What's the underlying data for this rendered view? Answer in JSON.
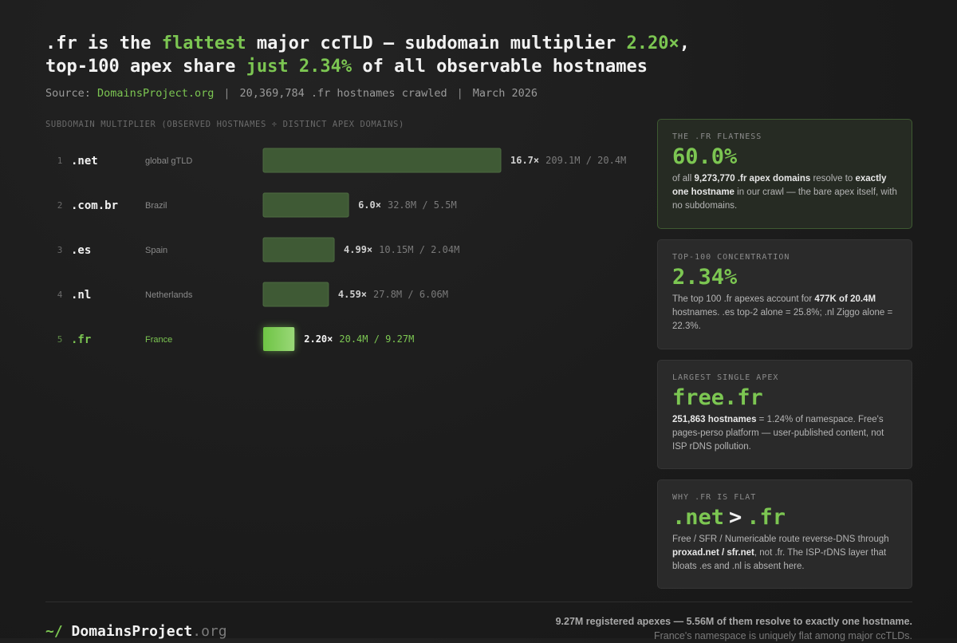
{
  "headline": {
    "l1_a": ".fr is the ",
    "l1_hl1": "flattest",
    "l1_b": " major ccTLD — subdomain multiplier ",
    "l1_hl2": "2.20×",
    "l1_c": ",",
    "l2_a": "top-100 apex share ",
    "l2_hl": "just 2.34%",
    "l2_b": " of all observable hostnames"
  },
  "source": {
    "prefix": "Source:",
    "link": "DomainsProject.org",
    "sep": "|",
    "crawl": "20,369,784 .fr hostnames crawled",
    "date": "March 2026"
  },
  "section_label": "SUBDOMAIN MULTIPLIER (OBSERVED HOSTNAMES ÷ DISTINCT APEX DOMAINS)",
  "chart_data": {
    "type": "bar",
    "orientation": "horizontal",
    "title": "",
    "xlabel": "",
    "ylabel": "",
    "xlim": [
      0,
      16.7
    ],
    "grid": false,
    "rows": [
      {
        "rank": "1",
        "tld": ".net",
        "country": "global gTLD",
        "value": 16.7,
        "value_label": "16.7×",
        "detail": "209.1M / 20.4M",
        "highlight": false
      },
      {
        "rank": "2",
        "tld": ".com.br",
        "country": "Brazil",
        "value": 6.0,
        "value_label": "6.0×",
        "detail": "32.8M / 5.5M",
        "highlight": false
      },
      {
        "rank": "3",
        "tld": ".es",
        "country": "Spain",
        "value": 4.99,
        "value_label": "4.99×",
        "detail": "10.15M / 2.04M",
        "highlight": false
      },
      {
        "rank": "4",
        "tld": ".nl",
        "country": "Netherlands",
        "value": 4.59,
        "value_label": "4.59×",
        "detail": "27.8M / 6.06M",
        "highlight": false
      },
      {
        "rank": "5",
        "tld": ".fr",
        "country": "France",
        "value": 2.2,
        "value_label": "2.20×",
        "detail": "20.4M / 9.27M",
        "highlight": true
      }
    ]
  },
  "cards": [
    {
      "label": "THE .FR FLATNESS",
      "big": "60.0%",
      "t1": "of all ",
      "b1": "9,273,770 .fr apex domains",
      "t2": " resolve to ",
      "b2": "exactly one hostname",
      "t3": " in our crawl — the bare apex itself, with no subdomains."
    },
    {
      "label": "TOP-100 CONCENTRATION",
      "big": "2.34%",
      "t1": "The top 100 .fr apexes account for ",
      "b1": "477K of 20.4M",
      "t2": " hostnames. .es top-2 alone = 25.8%; .nl Ziggo alone = 22.3%."
    },
    {
      "label": "LARGEST SINGLE APEX",
      "big": "free.fr",
      "b1": "251,863 hostnames",
      "t1": " = 1.24% of namespace. Free's pages-perso platform — user-published content, not ISP rDNS pollution."
    },
    {
      "label": "WHY .FR IS FLAT",
      "big_a": ".net",
      "big_gt": ">",
      "big_b": ".fr",
      "t1": "Free / SFR / Numericable route reverse-DNS through ",
      "b1": "proxad.net / sfr.net",
      "t2": ", not .fr. The ISP-rDNS layer that bloats .es and .nl is absent here."
    }
  ],
  "footer": {
    "logo_tilde": "~/",
    "logo_name": "DomainsProject",
    "logo_tld": ".org",
    "note_l1": "9.27M registered apexes — 5.56M of them resolve to exactly one hostname.",
    "note_l2": "France's namespace is uniquely flat among major ccTLDs."
  },
  "colors": {
    "accent": "#7cc652",
    "bar": "#3f5a35",
    "bar_highlight": "#7cc652",
    "background": "#1b1b1b"
  }
}
